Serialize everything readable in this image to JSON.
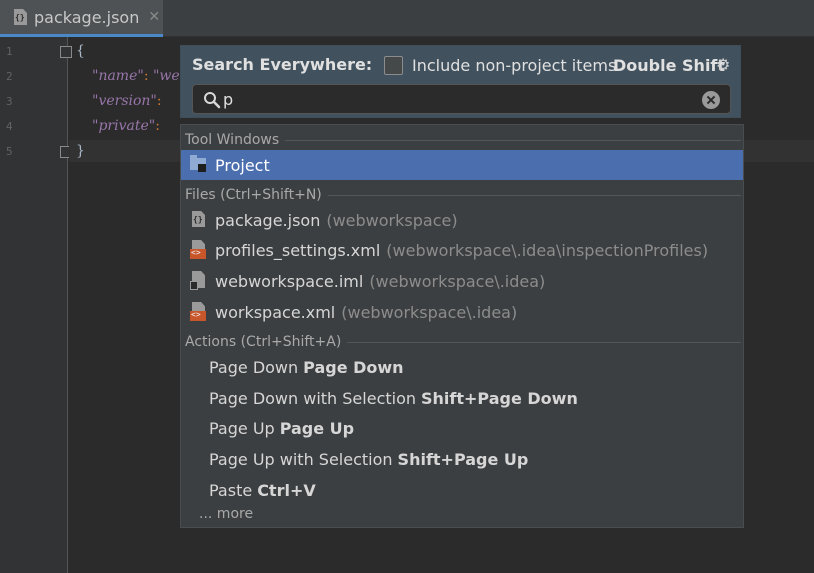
{
  "tab": {
    "filename": "package.json",
    "close": "✕"
  },
  "gutter": {
    "line_numbers": [
      "1",
      "2",
      "3",
      "4",
      "5"
    ]
  },
  "code": {
    "line1": "{",
    "line2_key": "\"name\"",
    "line2_rest": "\"we",
    "line3_key": "\"version\"",
    "line4_key": "\"private\"",
    "colon": ":",
    "line5": "}"
  },
  "popup": {
    "title": "Search Everywhere:",
    "checkbox_label": "Include non-project items",
    "shortcut": "Double Shift",
    "gear_icon": "⚙",
    "query": "p"
  },
  "results": {
    "tool_windows_header": "Tool Windows",
    "tool_windows": [
      {
        "label": "Project",
        "icon": "project-folder-icon",
        "selected": true
      }
    ],
    "files_header": "Files (Ctrl+Shift+N)",
    "files": [
      {
        "name": "package.json",
        "path": "(webworkspace)",
        "icon": "json-file-icon"
      },
      {
        "name": "profiles_settings.xml",
        "path": "(webworkspace\\.idea\\inspectionProfiles)",
        "icon": "xml-file-icon"
      },
      {
        "name": "webworkspace.iml",
        "path": "(webworkspace\\.idea)",
        "icon": "iml-file-icon"
      },
      {
        "name": "workspace.xml",
        "path": "(webworkspace\\.idea)",
        "icon": "xml-file-icon"
      }
    ],
    "actions_header": "Actions (Ctrl+Shift+A)",
    "actions": [
      {
        "name": "Page Down",
        "shortcut": "Page Down"
      },
      {
        "name": "Page Down with Selection",
        "shortcut": "Shift+Page Down"
      },
      {
        "name": "Page Up",
        "shortcut": "Page Up"
      },
      {
        "name": "Page Up with Selection",
        "shortcut": "Shift+Page Up"
      },
      {
        "name": "Paste",
        "shortcut": "Ctrl+V"
      }
    ],
    "more": "... more"
  }
}
